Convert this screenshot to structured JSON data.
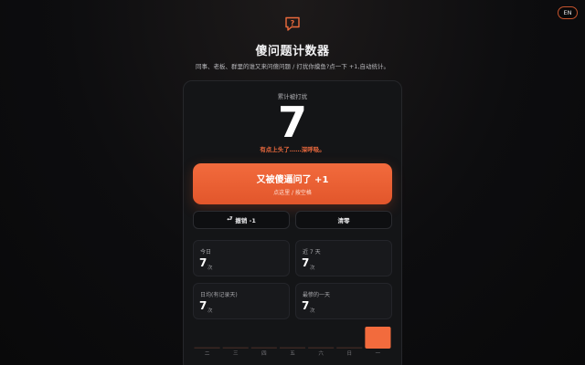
{
  "lang_button": "EN",
  "logo_icon": "question-bubble-icon",
  "app_title": "傻问题计数器",
  "subtitle": "同事、老板、群里的谁又来问傻问题 / 打扰你摸鱼?点一下 +1,自动统计。",
  "total": {
    "label": "累计被打扰",
    "value": "7",
    "mood": "有点上头了……深呼吸。"
  },
  "main_button": {
    "label": "又被傻逼问了 +1",
    "sub": "点这里 / 按空格"
  },
  "undo_button": {
    "icon": "undo-arrow-icon",
    "label": "撤销 -1"
  },
  "reset_button": {
    "label": "清零"
  },
  "stats": {
    "today": {
      "label": "今日",
      "value": "7",
      "unit": "次"
    },
    "last7": {
      "label": "近 7 天",
      "value": "7",
      "unit": "次"
    },
    "daily_avg": {
      "label": "日均(有记录天)",
      "value": "7",
      "unit": "次"
    },
    "worst_day": {
      "label": "最惨的一天",
      "value": "7",
      "unit": "次"
    }
  },
  "chart_data": {
    "type": "bar",
    "categories": [
      "二",
      "三",
      "四",
      "五",
      "六",
      "日",
      "一"
    ],
    "values": [
      0,
      0,
      0,
      0,
      0,
      0,
      7
    ],
    "ylim": [
      0,
      7
    ],
    "accent": "#f26b3d",
    "empty_color": "#3a2622"
  },
  "colors": {
    "accent": "#f26b3d",
    "background": "#0d0d0f",
    "card": "#141517"
  }
}
